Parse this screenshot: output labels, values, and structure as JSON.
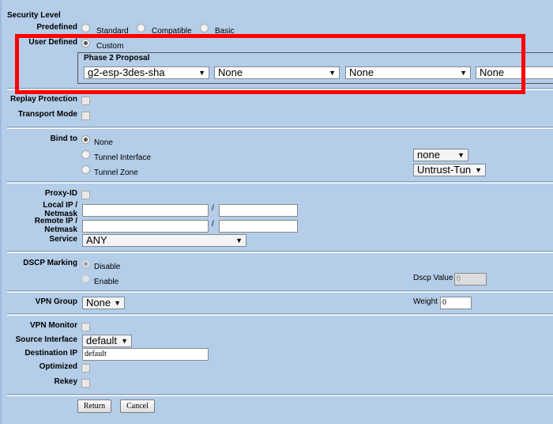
{
  "security_level": {
    "title": "Security Level",
    "predefined_label": "Predefined",
    "options_predefined": [
      "Standard",
      "Compatible",
      "Basic"
    ],
    "user_defined_label": "User Defined",
    "custom_label": "Custom",
    "phase2_title": "Phase 2 Proposal",
    "proposals": [
      "g2-esp-3des-sha",
      "None",
      "None",
      "None"
    ]
  },
  "replay_protection_label": "Replay Protection",
  "transport_mode_label": "Transport Mode",
  "bind": {
    "label": "Bind to",
    "options": [
      "None",
      "Tunnel Interface",
      "Tunnel Zone"
    ],
    "tunnel_interface_value": "none",
    "tunnel_zone_value": "Untrust-Tun"
  },
  "proxy": {
    "proxy_id_label": "Proxy-ID",
    "local_label_1": "Local IP /",
    "local_label_2": "Netmask",
    "remote_label_1": "Remote IP /",
    "remote_label_2": "Netmask",
    "slash": "/",
    "service_label": "Service",
    "service_value": "ANY"
  },
  "dscp": {
    "label": "DSCP Marking",
    "options": [
      "Disable",
      "Enable"
    ],
    "value_label": "Dscp Value",
    "value": "0"
  },
  "vpn_group": {
    "label": "VPN Group",
    "value": "None",
    "weight_label": "Weight",
    "weight_value": "0"
  },
  "monitor": {
    "vpn_monitor_label": "VPN Monitor",
    "source_interface_label": "Source Interface",
    "source_interface_value": "default",
    "destination_ip_label": "Destination IP",
    "destination_ip_value": "default",
    "optimized_label": "Optimized",
    "rekey_label": "Rekey"
  },
  "buttons": {
    "return": "Return",
    "cancel": "Cancel"
  },
  "colors": {
    "background": "#b4cde8",
    "highlight": "#ff0000"
  }
}
